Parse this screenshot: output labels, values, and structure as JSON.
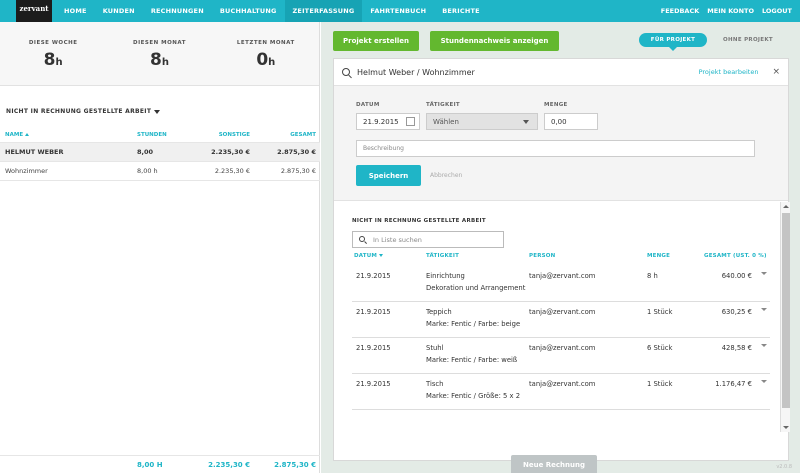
{
  "brand": {
    "logo_text": "zervant"
  },
  "nav": {
    "items": [
      "HOME",
      "KUNDEN",
      "RECHNUNGEN",
      "BUCHHALTUNG",
      "ZEITERFASSUNG",
      "FAHRTENBUCH",
      "BERICHTE"
    ],
    "active": "ZEITERFASSUNG",
    "right": [
      "FEEDBACK",
      "MEIN KONTO",
      "LOGOUT"
    ]
  },
  "stats": [
    {
      "label": "DIESE WOCHE",
      "value": "8",
      "unit": "h"
    },
    {
      "label": "DIESEN MONAT",
      "value": "8",
      "unit": "h"
    },
    {
      "label": "LETZTEN MONAT",
      "value": "0",
      "unit": "h"
    }
  ],
  "left": {
    "section_title": "NICHT IN RECHNUNG GESTELLTE ARBEIT",
    "columns": [
      "NAME",
      "STUNDEN",
      "SONSTIGE",
      "GESAMT"
    ],
    "rows": [
      {
        "name": "HELMUT WEBER",
        "hours": "8,00",
        "other": "2.235,30 €",
        "total": "2.875,30 €"
      },
      {
        "name": "Wohnzimmer",
        "hours": "8,00 h",
        "other": "2.235,30 €",
        "total": "2.875,30 €"
      }
    ],
    "totals": {
      "hours": "8,00 H",
      "other": "2.235,30 €",
      "total": "2.875,30 €"
    }
  },
  "actions": {
    "create_project": "Projekt erstellen",
    "show_timesheet": "Stundennachweis anzeigen"
  },
  "toggle": {
    "per_project": "FÜR PROJEKT",
    "no_project": "OHNE PROJEKT"
  },
  "panel": {
    "title": "Helmut Weber / Wohnzimmer",
    "edit_link": "Projekt bearbeiten",
    "close": "×",
    "form": {
      "date_label": "DATUM",
      "date_value": "21.9.2015",
      "activity_label": "TÄTIGKEIT",
      "activity_value": "Wählen",
      "quantity_label": "MENGE",
      "quantity_value": "0,00",
      "description_placeholder": "Beschreibung",
      "save": "Speichern",
      "cancel": "Abbrechen"
    },
    "list": {
      "title": "NICHT IN RECHNUNG GESTELLTE ARBEIT",
      "search_placeholder": "In Liste suchen",
      "columns": [
        "DATUM",
        "TÄTIGKEIT",
        "PERSON",
        "MENGE",
        "GESAMT (UST. 0 %)"
      ],
      "rows": [
        {
          "date": "21.9.2015",
          "activity": "Einrichtung",
          "detail": "Dekoration und Arrangement",
          "person": "tanja@zervant.com",
          "qty": "8 h",
          "total": "640.00 €"
        },
        {
          "date": "21.9.2015",
          "activity": "Teppich",
          "detail": "Marke: Fentic / Farbe: beige",
          "person": "tanja@zervant.com",
          "qty": "1 Stück",
          "total": "630,25 €"
        },
        {
          "date": "21.9.2015",
          "activity": "Stuhl",
          "detail": "Marke: Fentic / Farbe: weiß",
          "person": "tanja@zervant.com",
          "qty": "6 Stück",
          "total": "428,58 €"
        },
        {
          "date": "21.9.2015",
          "activity": "Tisch",
          "detail": "Marke: Fentic / Größe: 5 x 2",
          "person": "tanja@zervant.com",
          "qty": "1 Stück",
          "total": "1.176,47 €"
        }
      ]
    },
    "new_invoice": "Neue Rechnung"
  },
  "version": "v2.0.8",
  "colors": {
    "accent": "#1fb5c7",
    "green": "#63b82f",
    "background": "#e3ebe6"
  }
}
